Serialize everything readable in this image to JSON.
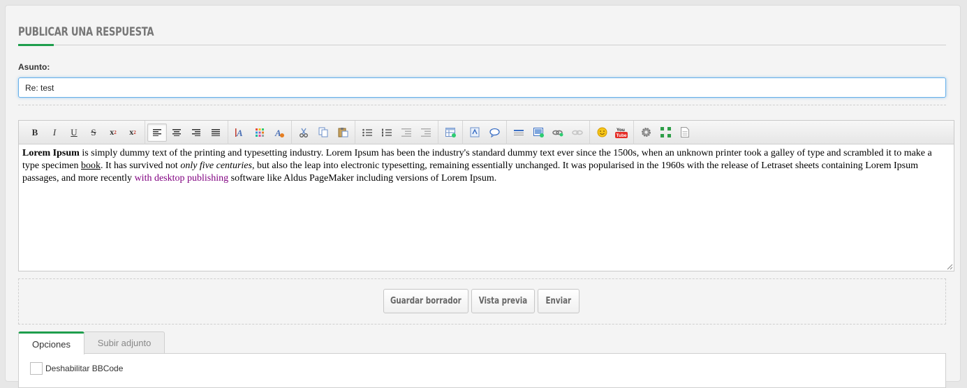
{
  "post_panel": {
    "title": "PUBLICAR UNA RESPUESTA",
    "subject_label": "Asunto:",
    "subject_value": "Re: test"
  },
  "toolbar": {
    "groups": [
      [
        "bold-icon",
        "italic-icon",
        "underline-icon",
        "strikethrough-icon",
        "subscript-icon",
        "superscript-icon"
      ],
      [
        "align-left-icon",
        "align-center-icon",
        "align-right-icon",
        "justify-icon"
      ],
      [
        "font-icon",
        "color-palette-icon",
        "remove-format-icon"
      ],
      [
        "cut-icon",
        "copy-icon",
        "paste-icon"
      ],
      [
        "bullet-list-icon",
        "numbered-list-icon",
        "outdent-icon",
        "indent-icon"
      ],
      [
        "table-icon"
      ],
      [
        "code-icon",
        "quote-icon"
      ],
      [
        "horizontal-rule-icon",
        "image-icon",
        "link-icon",
        "unlink-icon"
      ],
      [
        "emoticon-icon",
        "youtube-icon"
      ],
      [
        "settings-icon",
        "maximize-icon",
        "source-icon"
      ]
    ],
    "active": "align-left-icon",
    "labels": {
      "bold": "B",
      "italic": "I",
      "underline": "U",
      "strike": "S",
      "sub": "x",
      "sup": "x",
      "sub_mark": "2",
      "sup_mark": "2",
      "youtube_top": "You",
      "youtube_bottom": "Tube"
    }
  },
  "editor_content": {
    "p1_bold": "Lorem Ipsum",
    "p1_a": " is simply dummy text of the printing and typesetting industry. Lorem Ipsum has been the industry's standard dummy text ever since the 1500s, when an unknown printer took a galley of type and scrambled it to make a type specimen ",
    "p1_underlined": "book",
    "p1_b": ". It has survived not ",
    "p1_italic": "only five centuries",
    "p1_c": ", but also the leap into electronic typesetting, remaining essentially unchanged. It was popularised in the 1960s with the release of Letraset sheets containing Lorem Ipsum passages, and more recently ",
    "p1_link": "with desktop publishing",
    "p1_d": " software like Aldus PageMaker including versions of Lorem Ipsum."
  },
  "actions": {
    "save_draft": "Guardar borrador",
    "preview": "Vista previa",
    "submit": "Enviar"
  },
  "tabs": {
    "options": "Opciones",
    "upload": "Subir adjunto"
  },
  "options": {
    "disable_bbcode": "Deshabilitar BBCode"
  },
  "colors": {
    "accent": "#1f9e4d",
    "link": "#800080",
    "focus": "#66afe9"
  }
}
